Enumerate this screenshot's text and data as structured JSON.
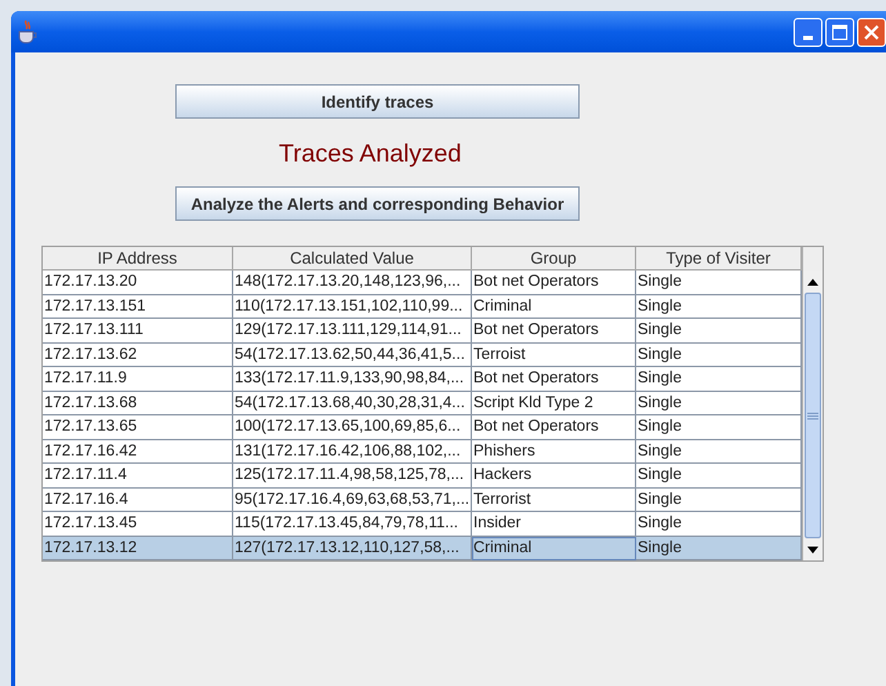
{
  "buttons": [
    {
      "label": "Identify traces"
    },
    {
      "label": "Analyze the Alerts and corresponding Behavior"
    }
  ],
  "status_label": "Traces Analyzed",
  "table": {
    "columns": [
      "IP Address",
      "Calculated Value",
      "Group",
      "Type of Visiter"
    ],
    "rows": [
      {
        "cells": [
          "172.17.13.20",
          "148(172.17.13.20,148,123,96,...",
          "Bot net Operators",
          "Single"
        ],
        "selected": false
      },
      {
        "cells": [
          "172.17.13.151",
          "110(172.17.13.151,102,110,99...",
          "Criminal",
          "Single"
        ],
        "selected": false
      },
      {
        "cells": [
          "172.17.13.111",
          "129(172.17.13.111,129,114,91...",
          "Bot net Operators",
          "Single"
        ],
        "selected": false
      },
      {
        "cells": [
          "172.17.13.62",
          "54(172.17.13.62,50,44,36,41,5...",
          "Terroist",
          "Single"
        ],
        "selected": false
      },
      {
        "cells": [
          "172.17.11.9",
          "133(172.17.11.9,133,90,98,84,...",
          "Bot net Operators",
          "Single"
        ],
        "selected": false
      },
      {
        "cells": [
          "172.17.13.68",
          "54(172.17.13.68,40,30,28,31,4...",
          "Script Kld Type 2",
          "Single"
        ],
        "selected": false
      },
      {
        "cells": [
          "172.17.13.65",
          "100(172.17.13.65,100,69,85,6...",
          "Bot net Operators",
          "Single"
        ],
        "selected": false
      },
      {
        "cells": [
          "172.17.16.42",
          "131(172.17.16.42,106,88,102,...",
          "Phishers",
          "Single"
        ],
        "selected": false
      },
      {
        "cells": [
          "172.17.11.4",
          "125(172.17.11.4,98,58,125,78,...",
          "Hackers",
          "Single"
        ],
        "selected": false
      },
      {
        "cells": [
          "172.17.16.4",
          "95(172.17.16.4,69,63,68,53,71,...",
          "Terrorist",
          "Single"
        ],
        "selected": false
      },
      {
        "cells": [
          "172.17.13.45",
          "115(172.17.13.45,84,79,78,11...",
          "Insider",
          "Single"
        ],
        "selected": false
      },
      {
        "cells": [
          "172.17.13.12",
          "127(172.17.13.12,110,127,58,...",
          "Criminal",
          "Single"
        ],
        "selected": true
      }
    ]
  }
}
